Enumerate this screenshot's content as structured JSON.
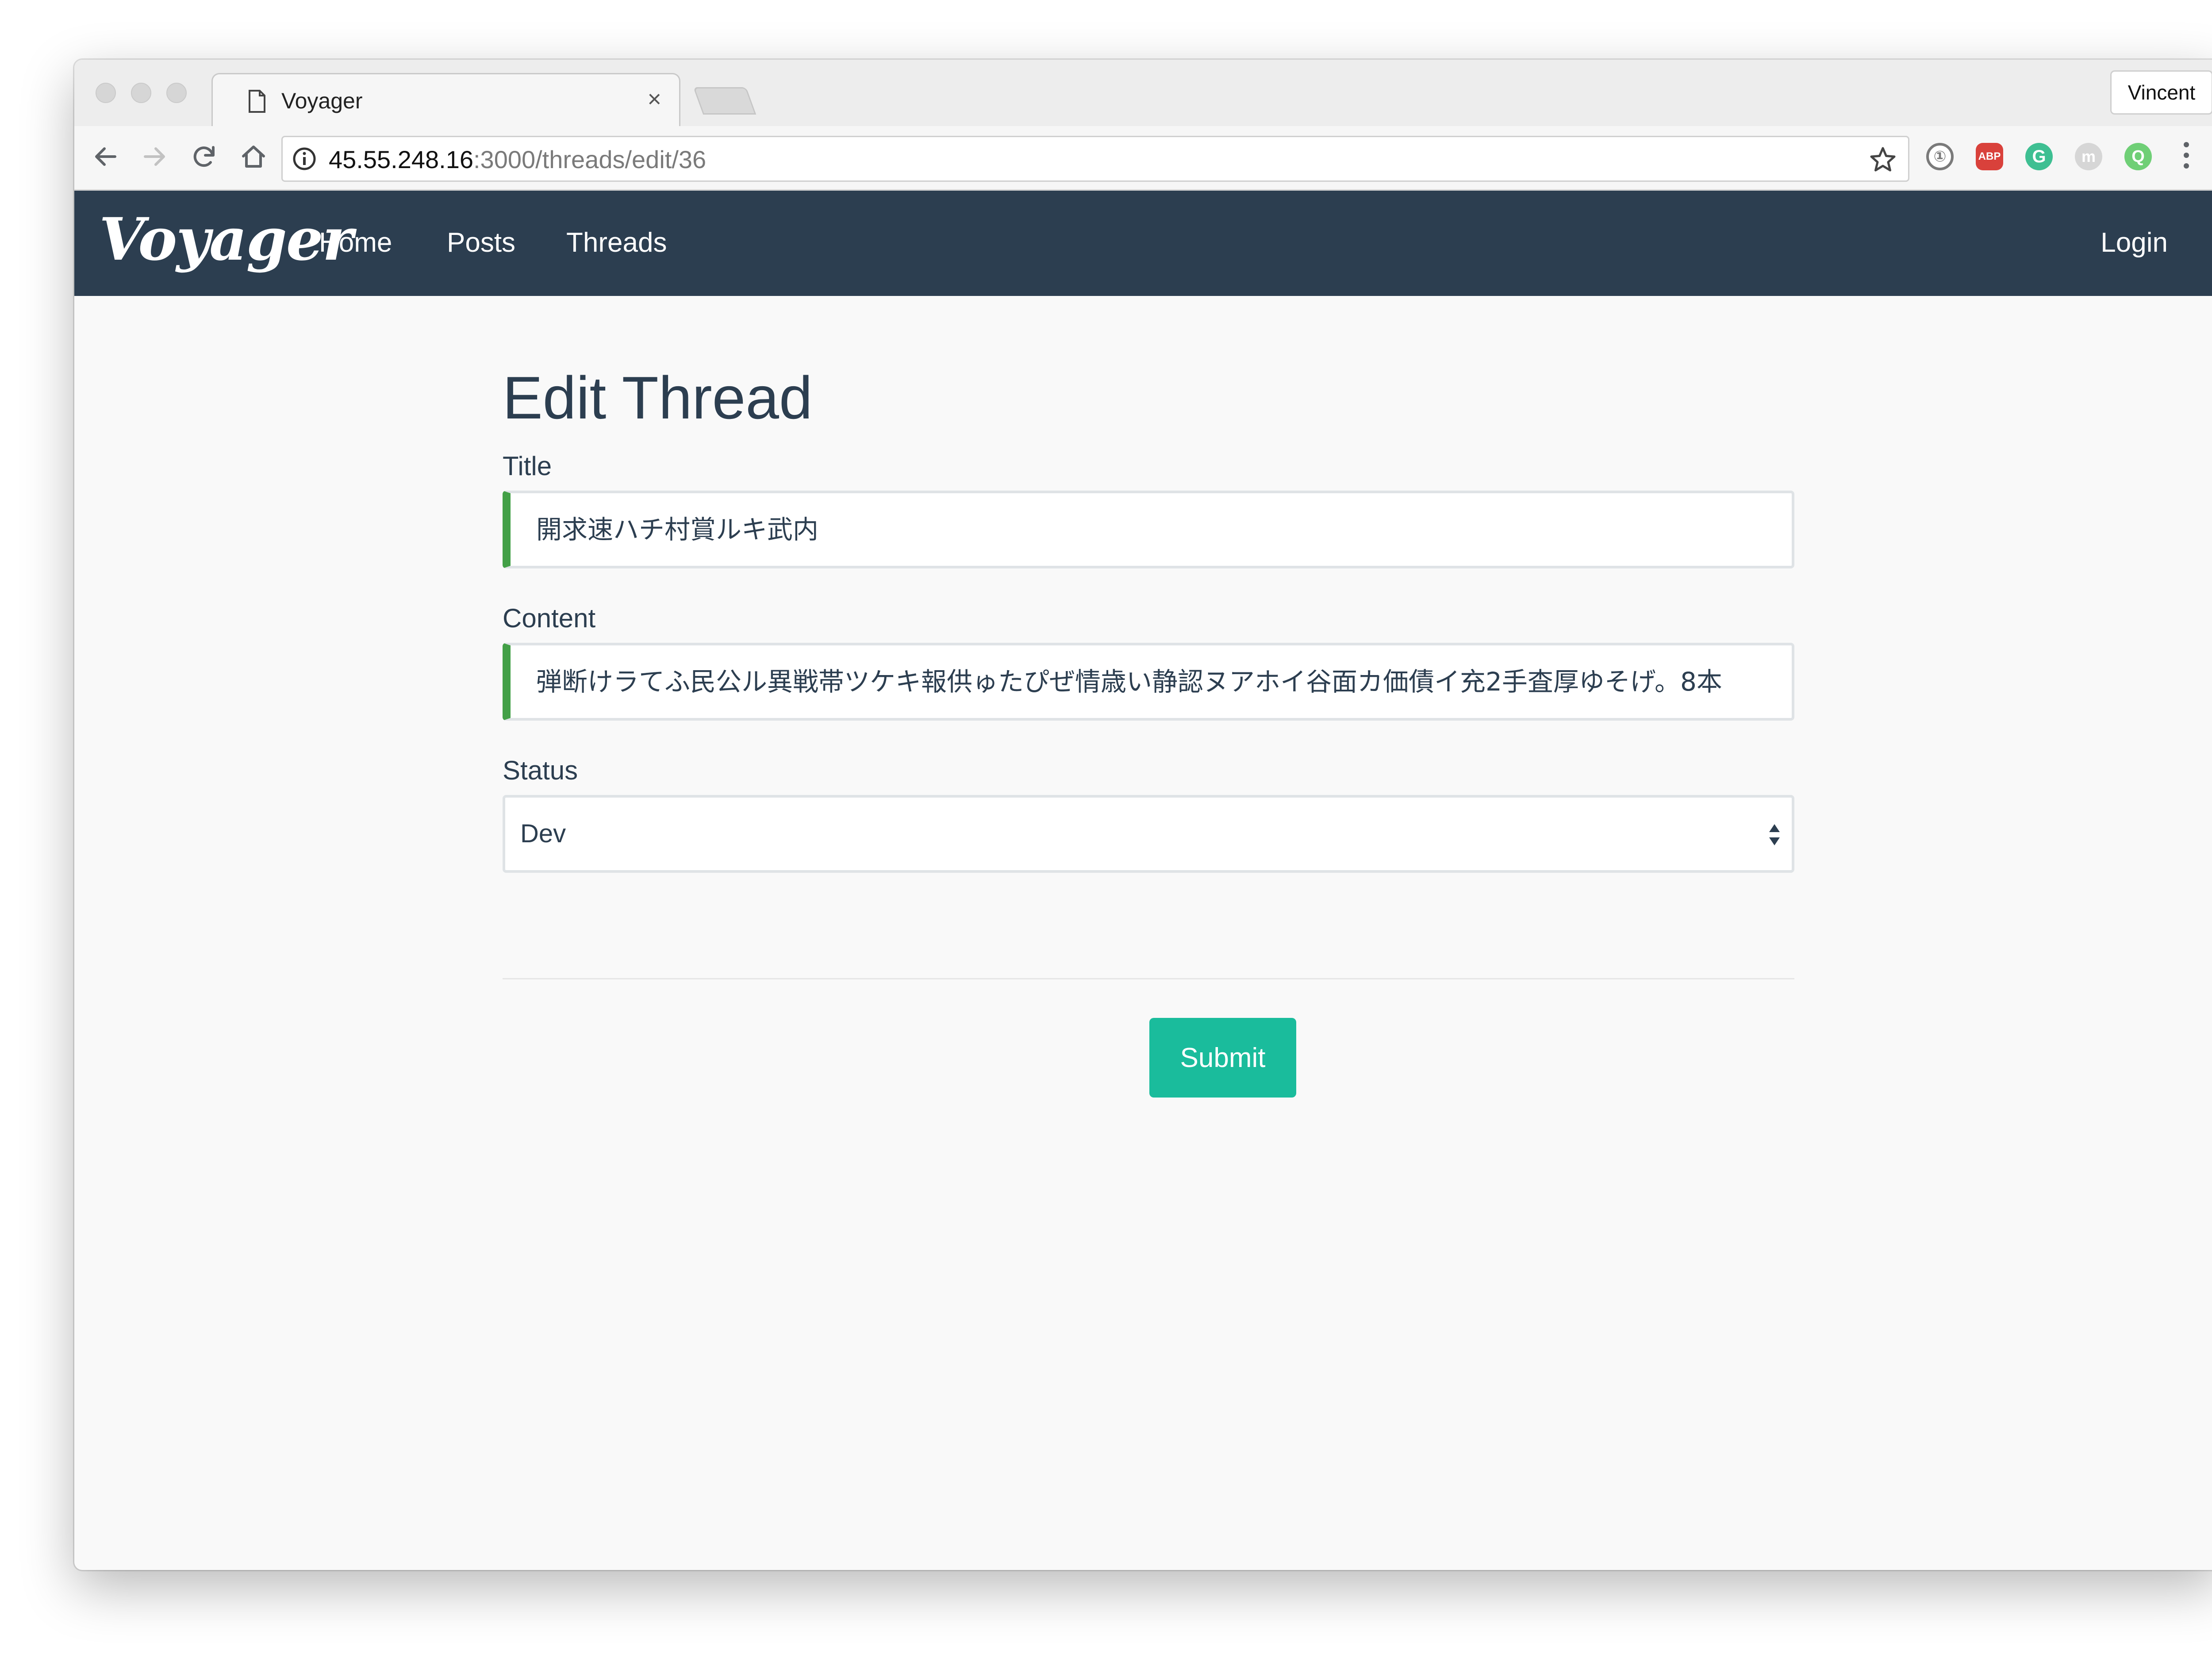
{
  "browser": {
    "tab_title": "Voyager",
    "tab_close": "×",
    "profile_name": "Vincent",
    "url_host": "45.55.248.16",
    "url_path": ":3000/threads/edit/36",
    "extensions": {
      "one_password": "①",
      "adblock": "ABP",
      "grammarly": "G",
      "m_ext": "m",
      "q_ext": "Q"
    }
  },
  "navbar": {
    "brand": "Voyager",
    "links": [
      "Home",
      "Posts",
      "Threads"
    ],
    "login": "Login",
    "bg_color": "#2c3e50"
  },
  "form": {
    "heading": "Edit Thread",
    "title_label": "Title",
    "title_value": "開求速ハチ村賞ルキ武内",
    "content_label": "Content",
    "content_value": "弾断けラてふ民公ル異戦帯ツケキ報供ゅたぴぜ情歳い静認ヌアホイ谷面カ価債イ充2手査厚ゆそげ。8本",
    "status_label": "Status",
    "status_value": "Dev",
    "submit_label": "Submit",
    "valid_color": "#43a047",
    "submit_color": "#1abc9c"
  }
}
